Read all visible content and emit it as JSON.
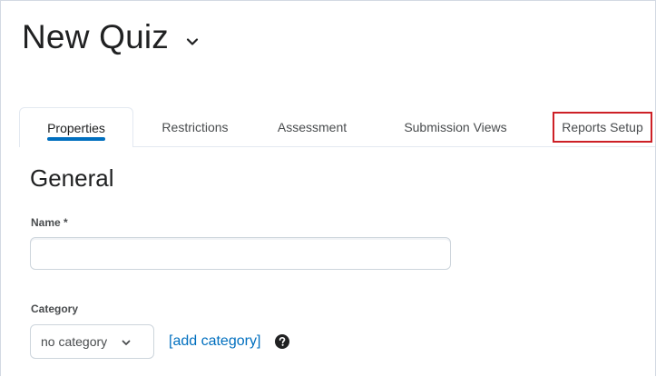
{
  "page": {
    "title": "New Quiz",
    "title_chevron_icon": "chevron-down-icon"
  },
  "tabs": [
    {
      "label": "Properties",
      "active": true
    },
    {
      "label": "Restrictions",
      "active": false
    },
    {
      "label": "Assessment",
      "active": false
    },
    {
      "label": "Submission Views",
      "active": false
    },
    {
      "label": "Reports Setup",
      "active": false,
      "highlighted": true
    }
  ],
  "section": {
    "heading": "General"
  },
  "name_field": {
    "label": "Name",
    "required_marker": "*",
    "label_full": "Name *",
    "value": "",
    "placeholder": ""
  },
  "category_field": {
    "label": "Category",
    "selected": "no category",
    "add_link": "[add category]",
    "help_icon": "question-circle-icon"
  },
  "colors": {
    "accent": "#006fbf",
    "highlight_border": "#cd2026",
    "text": "#202122",
    "muted_text": "#494c4e",
    "border": "#cdd5dc"
  }
}
